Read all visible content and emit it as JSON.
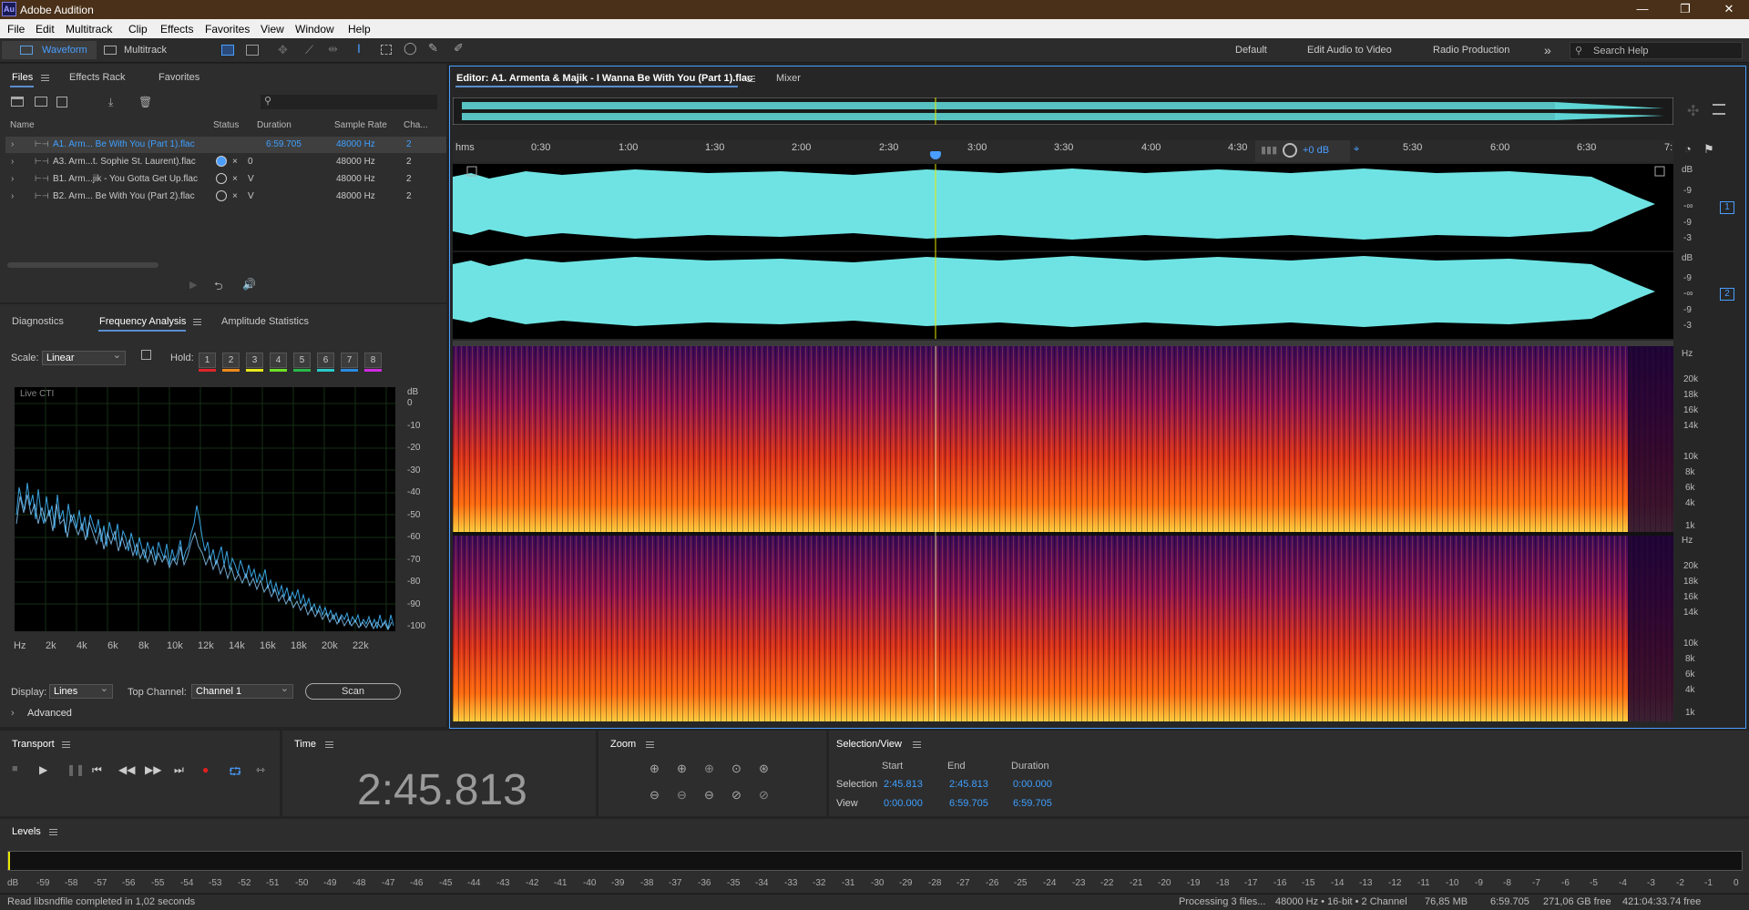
{
  "app": {
    "title": "Adobe Audition",
    "logo": "Au"
  },
  "menu": [
    "File",
    "Edit",
    "Multitrack",
    "Clip",
    "Effects",
    "Favorites",
    "View",
    "Window",
    "Help"
  ],
  "toolbar": {
    "waveform": "Waveform",
    "multitrack": "Multitrack",
    "workspaces": [
      "Default",
      "Edit Audio to Video",
      "Radio Production"
    ],
    "more": "»",
    "search_placeholder": "Search Help"
  },
  "files_panel": {
    "tabs": [
      "Files",
      "Effects Rack",
      "Favorites"
    ],
    "columns": [
      "Name",
      "Status",
      "Duration",
      "Sample Rate",
      "Cha..."
    ],
    "files": [
      {
        "name": "A1. Arm... Be With You (Part 1).flac",
        "duration": "6:59.705",
        "rate": "48000 Hz",
        "ch": "2",
        "selected": true
      },
      {
        "name": "A3. Arm...t. Sophie St. Laurent).flac",
        "status": "0",
        "rate": "48000 Hz",
        "ch": "2"
      },
      {
        "name": "B1. Arm...jik - You Gotta Get Up.flac",
        "status": "V",
        "rate": "48000 Hz",
        "ch": "2"
      },
      {
        "name": "B2. Arm... Be With You (Part 2).flac",
        "status": "V",
        "rate": "48000 Hz",
        "ch": "2"
      }
    ]
  },
  "analysis_panel": {
    "tabs": [
      "Diagnostics",
      "Frequency Analysis",
      "Amplitude Statistics"
    ],
    "scale_label": "Scale:",
    "scale_value": "Linear",
    "hold_label": "Hold:",
    "hold": [
      "1",
      "2",
      "3",
      "4",
      "5",
      "6",
      "7",
      "8"
    ],
    "hold_colors": [
      "#e0242a",
      "#f08a1c",
      "#e8e81c",
      "#6ee02a",
      "#2ab84a",
      "#2ac8c8",
      "#2a8ae0",
      "#d02ae0"
    ],
    "graph_label": "Live CTI",
    "db_unit": "dB",
    "db_ticks": [
      "0",
      "-10",
      "-20",
      "-30",
      "-40",
      "-50",
      "-60",
      "-70",
      "-80",
      "-90",
      "-100"
    ],
    "hz_ticks": [
      "Hz",
      "2k",
      "4k",
      "6k",
      "8k",
      "10k",
      "12k",
      "14k",
      "16k",
      "18k",
      "20k",
      "22k"
    ],
    "display_label": "Display:",
    "display_value": "Lines",
    "top_channel_label": "Top Channel:",
    "top_channel_value": "Channel 1",
    "scan": "Scan",
    "advanced": "Advanced"
  },
  "editor": {
    "tab": "Editor: A1. Armenta & Majik - I Wanna Be With You (Part 1).flac",
    "mixer": "Mixer",
    "ruler_unit": "hms",
    "ruler": [
      "0:30",
      "1:00",
      "1:30",
      "2:00",
      "2:30",
      "3:00",
      "3:30",
      "4:00",
      "4:30",
      "5:30",
      "6:00",
      "6:30",
      "7:"
    ],
    "gain": "+0 dB",
    "db_ch": [
      "dB",
      "-9",
      "-∞",
      "-9",
      "-3"
    ],
    "channels": [
      "1",
      "2"
    ],
    "hz_unit": "Hz",
    "hz_ticks": [
      "20k",
      "18k",
      "16k",
      "14k",
      "10k",
      "8k",
      "6k",
      "4k",
      "1k"
    ],
    "playhead_frac": 0.395
  },
  "transport": {
    "title": "Transport"
  },
  "time": {
    "title": "Time",
    "value": "2:45.813"
  },
  "zoom": {
    "title": "Zoom"
  },
  "selection": {
    "title": "Selection/View",
    "cols": [
      "Start",
      "End",
      "Duration"
    ],
    "rows": [
      {
        "label": "Selection",
        "start": "2:45.813",
        "end": "2:45.813",
        "duration": "0:00.000"
      },
      {
        "label": "View",
        "start": "0:00.000",
        "end": "6:59.705",
        "duration": "6:59.705"
      }
    ]
  },
  "levels": {
    "title": "Levels",
    "ticks": [
      "dB",
      "-59",
      "-58",
      "-57",
      "-56",
      "-55",
      "-54",
      "-53",
      "-52",
      "-51",
      "-50",
      "-49",
      "-48",
      "-47",
      "-46",
      "-45",
      "-44",
      "-43",
      "-42",
      "-41",
      "-40",
      "-39",
      "-38",
      "-37",
      "-36",
      "-35",
      "-34",
      "-33",
      "-32",
      "-31",
      "-30",
      "-29",
      "-28",
      "-27",
      "-26",
      "-25",
      "-24",
      "-23",
      "-22",
      "-21",
      "-20",
      "-19",
      "-18",
      "-17",
      "-16",
      "-15",
      "-14",
      "-13",
      "-12",
      "-11",
      "-10",
      "-9",
      "-8",
      "-7",
      "-6",
      "-5",
      "-4",
      "-3",
      "-2",
      "-1",
      "0"
    ]
  },
  "status": {
    "left": "Read libsndfile completed in 1,02 seconds",
    "processing": "Processing 3 files...",
    "format": "48000 Hz • 16-bit • 2 Channel",
    "size": "76,85 MB",
    "duration": "6:59.705",
    "free": "271,06 GB free",
    "time_free": "421:04:33.74 free"
  }
}
